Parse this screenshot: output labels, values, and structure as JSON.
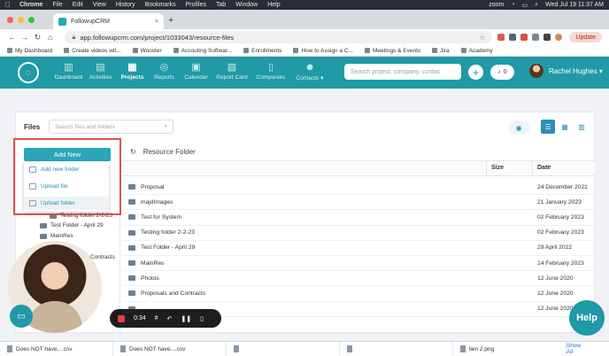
{
  "menubar": {
    "apple": "",
    "items": [
      "Chrome",
      "File",
      "Edit",
      "View",
      "History",
      "Bookmarks",
      "Profiles",
      "Tab",
      "Window",
      "Help"
    ],
    "zoom": "zoom",
    "clock": "Wed Jul 19  11:37 AM"
  },
  "browser": {
    "tab_title": "FollowupCRM",
    "tab_close": "×",
    "new_tab": "+",
    "url": "app.followupcrm.com/project/1033043/resource-files",
    "update_label": "Update",
    "back": "←",
    "forward": "→",
    "reload": "↻",
    "home": "⌂"
  },
  "bookmarks": [
    "My Dashboard",
    "Create videos wit...",
    "Wooster",
    "Accouting Softwar...",
    "Enrollments",
    "How to Assign a C...",
    "Meetings & Events",
    "Jira",
    "Academy"
  ],
  "app": {
    "nav": [
      {
        "label": "Dashboard",
        "icon": "▥"
      },
      {
        "label": "Activities",
        "icon": "▤"
      },
      {
        "label": "Projects",
        "icon": "▦"
      },
      {
        "label": "Reports",
        "icon": "◎"
      },
      {
        "label": "Calendar",
        "icon": "▣"
      },
      {
        "label": "Report Card",
        "icon": "▧"
      },
      {
        "label": "Companies",
        "icon": "▯"
      },
      {
        "label": "Contacts ▾",
        "icon": "☻"
      }
    ],
    "search_placeholder": "Search project, company, contac",
    "notification_count": "0",
    "user_name": "Rachel Hughes ▾",
    "accent": "#1f9aa6"
  },
  "files": {
    "title": "Files",
    "search_placeholder": "Search files and folders",
    "add_new": "Add New",
    "menu": [
      "Add new folder",
      "Upload file",
      "Upload folder"
    ],
    "tree": [
      "Testing folder 2-2-23",
      "Test Folder - April 29",
      "MainRes",
      "Contracts"
    ],
    "resource_folder": "Resource Folder",
    "columns": {
      "size": "Size",
      "date": "Date"
    },
    "rows": [
      {
        "name": "Proposal",
        "date": "24 December 2021"
      },
      {
        "name": "majdImages",
        "date": "21 January 2023"
      },
      {
        "name": "Test for System",
        "date": "02 February 2023"
      },
      {
        "name": "Testing folder 2-2-23",
        "date": "02 February 2023"
      },
      {
        "name": "Test Folder - April 29",
        "date": "29 April 2022"
      },
      {
        "name": "MainRes",
        "date": "14 February 2023"
      },
      {
        "name": "Photos",
        "date": "12 June 2020"
      },
      {
        "name": "Proposals and Contracts",
        "date": "12 June 2020"
      },
      {
        "name": "",
        "date": "12 June 2020"
      }
    ]
  },
  "recorder": {
    "time": "0:34"
  },
  "help_label": "Help",
  "downloads": [
    "Does NOT have....csv",
    "Does NOT have....csv",
    "",
    "",
    "lien 2.png"
  ],
  "show_all": "Show All"
}
